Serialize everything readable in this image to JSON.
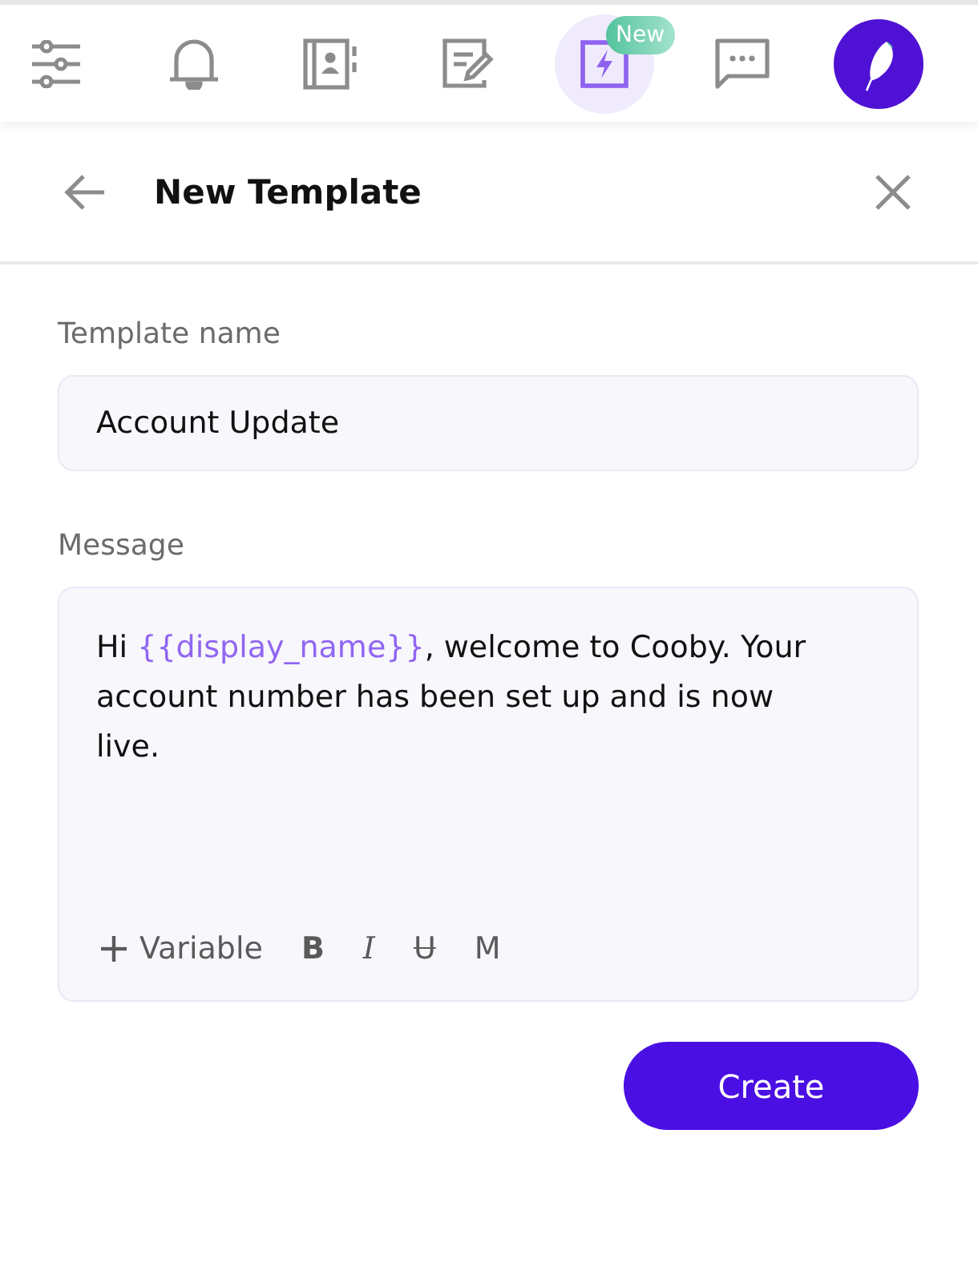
{
  "nav": {
    "items": [
      {
        "selected": false
      },
      {
        "selected": false
      },
      {
        "selected": false
      },
      {
        "selected": false
      },
      {
        "selected": true,
        "badge": "New"
      },
      {
        "selected": false
      }
    ]
  },
  "header": {
    "title": "New Template"
  },
  "template_name": {
    "label": "Template name",
    "value": "Account Update"
  },
  "message": {
    "label": "Message",
    "segments": [
      {
        "kind": "text",
        "text": "Hi "
      },
      {
        "kind": "variable",
        "text": "{{display_name}}"
      },
      {
        "kind": "text",
        "text": ", welcome to Cooby. Your account number has been set up and is now live."
      }
    ],
    "toolbar": [
      {
        "kind": "variable",
        "label": "Variable"
      },
      {
        "kind": "bold",
        "label": "B"
      },
      {
        "kind": "italic",
        "label": "I"
      },
      {
        "kind": "strike",
        "label": "U"
      },
      {
        "kind": "mono",
        "label": "M"
      }
    ]
  },
  "create_button": {
    "label": "Create"
  }
}
